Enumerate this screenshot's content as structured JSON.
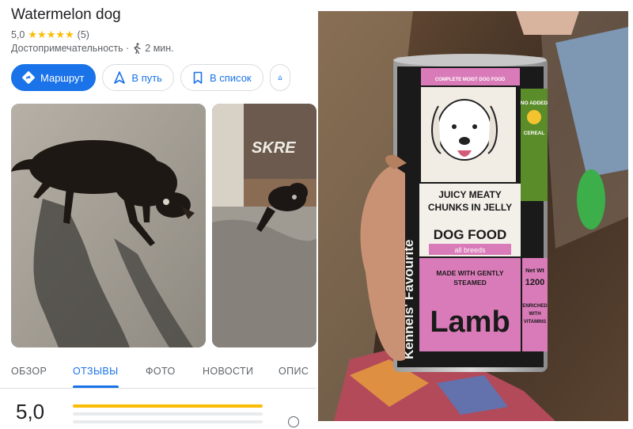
{
  "place": {
    "title": "Watermelon dog",
    "rating": "5,0",
    "stars": "★★★★★",
    "review_count": "(5)",
    "category": "Достопримечательность ·",
    "walk_time": "2 мин."
  },
  "actions": {
    "route": "Маршрут",
    "start": "В путь",
    "save": "В список"
  },
  "tabs": {
    "overview": "ОБЗОР",
    "reviews": "ОТЗЫВЫ",
    "photos": "ФОТО",
    "news": "НОВОСТИ",
    "about": "ОПИС"
  },
  "reviews_summary": {
    "score": "5,0"
  },
  "photos": {
    "photo1_icon": "dog-photo",
    "photo2_graffiti": "SKRE"
  },
  "can": {
    "brand": "Kennels' Favourite",
    "tagline": "COMPLETE MOIST DOG FOOD",
    "headline_line1": "JUICY MEATY",
    "headline_line2": "CHUNKS IN JELLY",
    "product": "DOG FOOD",
    "breeds": "all breeds",
    "made_with_line1": "MADE WITH GENTLY",
    "made_with_line2": "STEAMED",
    "flavor": "Lamb",
    "badge_no_added": "NO ADDED",
    "badge_cereal": "CEREAL",
    "net_weight_label": "Net Wt",
    "net_weight": "1200",
    "enriched_line1": "ENRICHED",
    "enriched_line2": "WITH",
    "enriched_line3": "VITAMINS"
  },
  "colors": {
    "accent": "#1a73e8",
    "star": "#fbbc04",
    "can_pink": "#d97bb8",
    "can_green": "#5b8c2a"
  }
}
